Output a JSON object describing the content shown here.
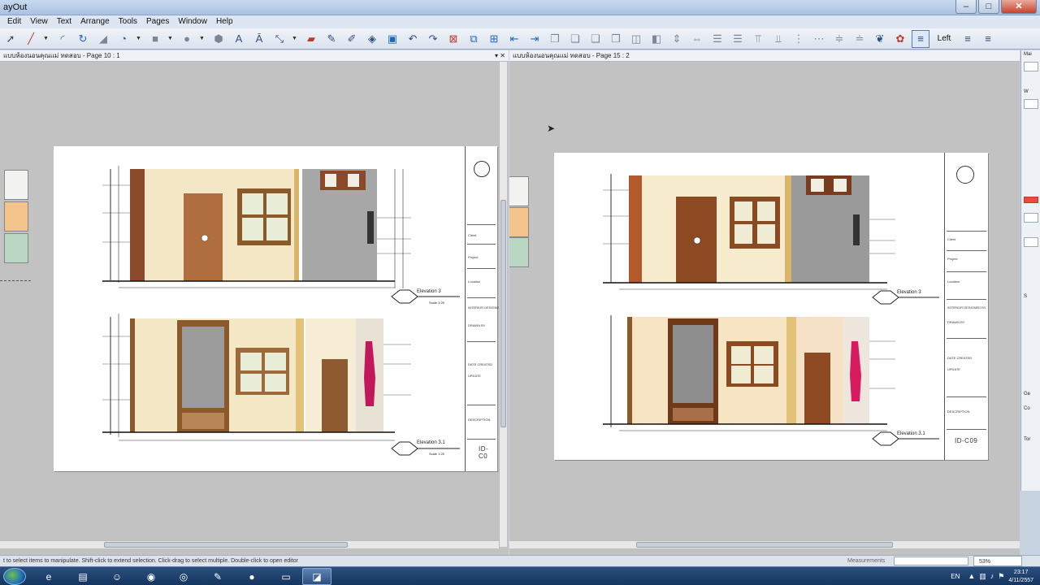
{
  "app": {
    "title": "ayOut",
    "min": "–",
    "max": "□",
    "close": "✕"
  },
  "menu": [
    "Edit",
    "View",
    "Text",
    "Arrange",
    "Tools",
    "Pages",
    "Window",
    "Help"
  ],
  "toolbar": {
    "align_left_label": "Left"
  },
  "left_panel": {
    "tab_title": "แบบห้องนอนคุณแม่ ทดสอบ - Page 10 : 1",
    "sheet_no": "ID-C0",
    "elev_a": "Elevation 3",
    "elev_b": "Elevation 3.1",
    "scale": "Scale 1:25"
  },
  "right_panel": {
    "tab_title": "แบบห้องนอนคุณแม่ ทดสอบ - Page 15 : 2",
    "sheet_no": "ID-C09",
    "elev_a": "Elevation 3",
    "elev_b": "Elevation 3.1",
    "scale": "Scale 1:25"
  },
  "titleblock": [
    "Client",
    "Project",
    "Location",
    "INTERIOR DESIGNED BY",
    "DRAWN BY",
    "DATE CREATED",
    "UPDATE",
    "DESCRIPTION"
  ],
  "swatches": [
    "#f2f2f0",
    "#f2c48c",
    "#b9d6c5"
  ],
  "statusbar": {
    "hint": "t to select items to manipulate. Shift-click to extend selection. Click-drag to select multiple. Double-click to open editor",
    "measurements_label": "Measurements",
    "zoom": "53%"
  },
  "tray": {
    "lang": "EN",
    "time": "23:17",
    "date": "4/11/2557"
  },
  "right_dock": [
    "Mai",
    "W",
    "Ge",
    "Co",
    "Tor",
    "S"
  ]
}
